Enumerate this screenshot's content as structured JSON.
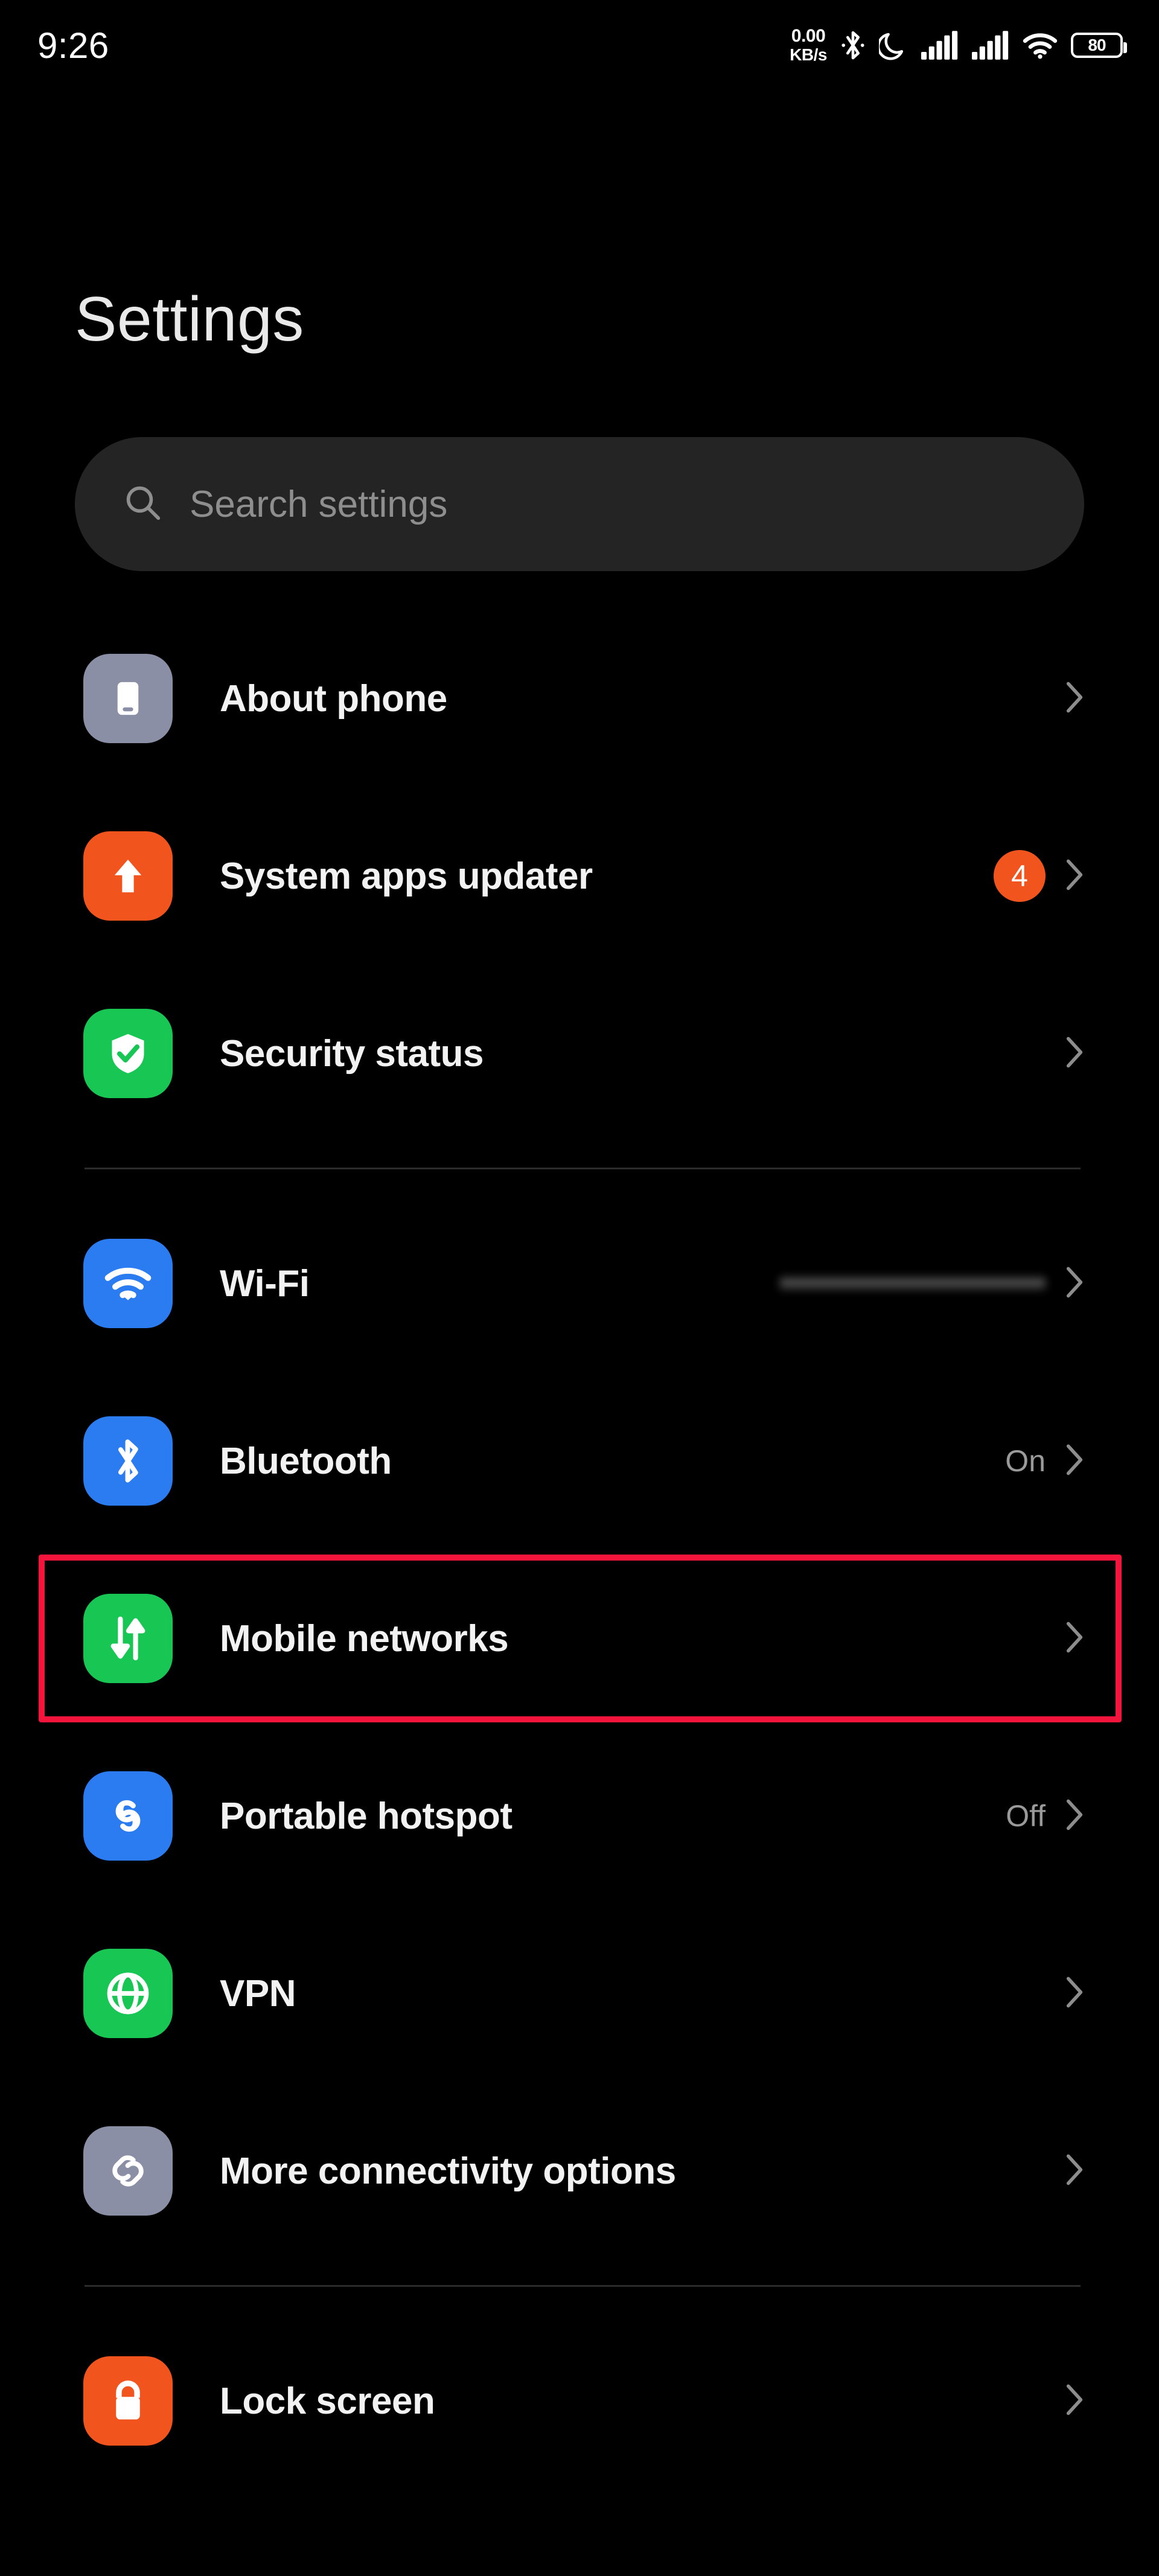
{
  "status_bar": {
    "clock": "9:26",
    "network_speed_value": "0.00",
    "network_speed_unit": "KB/s",
    "icons": [
      "bluetooth-icon",
      "do-not-disturb-moon-icon",
      "signal-icon-sim1",
      "signal-icon-sim2",
      "wifi-icon"
    ],
    "battery_percent": "80"
  },
  "header": {
    "title": "Settings"
  },
  "search": {
    "placeholder": "Search settings",
    "icon": "search-icon"
  },
  "groups": [
    {
      "items": [
        {
          "label": "About phone",
          "icon": "phone-icon",
          "icon_color": "#8b8fa6",
          "value": "",
          "badge": "",
          "chevron": true
        },
        {
          "label": "System apps updater",
          "icon": "up-arrow-icon",
          "icon_color": "#f1541d",
          "value": "",
          "badge": "4",
          "chevron": true
        },
        {
          "label": "Security status",
          "icon": "shield-check-icon",
          "icon_color": "#17c653",
          "value": "",
          "badge": "",
          "chevron": true
        }
      ]
    },
    {
      "items": [
        {
          "label": "Wi-Fi",
          "icon": "wifi-icon",
          "icon_color": "#2a7cf0",
          "value": "",
          "redacted": true,
          "badge": "",
          "chevron": true
        },
        {
          "label": "Bluetooth",
          "icon": "bluetooth-icon",
          "icon_color": "#2a7cf0",
          "value": "On",
          "badge": "",
          "chevron": true
        },
        {
          "label": "Mobile networks",
          "icon": "mobile-data-arrows-icon",
          "icon_color": "#17c653",
          "value": "",
          "badge": "",
          "chevron": true,
          "highlighted": true
        },
        {
          "label": "Portable hotspot",
          "icon": "hotspot-loops-icon",
          "icon_color": "#2a7cf0",
          "value": "Off",
          "badge": "",
          "chevron": true
        },
        {
          "label": "VPN",
          "icon": "globe-icon",
          "icon_color": "#17c653",
          "value": "",
          "badge": "",
          "chevron": true
        },
        {
          "label": "More connectivity options",
          "icon": "link-chain-icon",
          "icon_color": "#8b8fa6",
          "value": "",
          "badge": "",
          "chevron": true
        }
      ]
    },
    {
      "items": [
        {
          "label": "Lock screen",
          "icon": "lock-icon",
          "icon_color": "#f1541d",
          "value": "",
          "badge": "",
          "chevron": true
        }
      ]
    }
  ],
  "annotation": {
    "target": "Mobile networks",
    "color": "#f4143c"
  }
}
